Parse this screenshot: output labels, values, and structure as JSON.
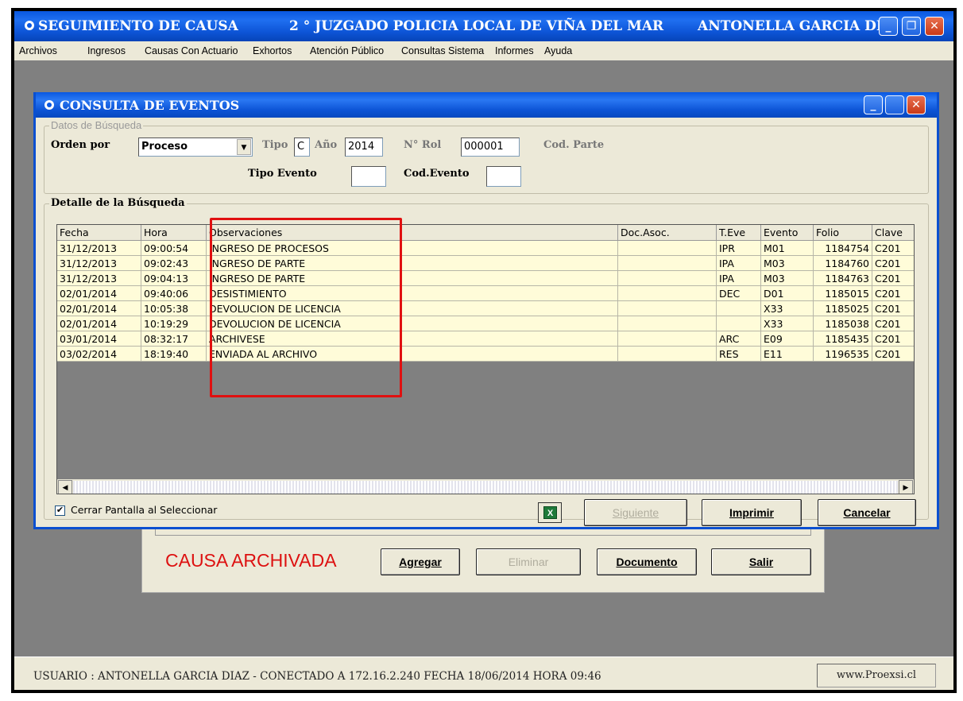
{
  "window": {
    "title_left": "SEGUIMIENTO DE CAUSA",
    "title_center": "2 ° JUZGADO POLICIA LOCAL DE VIÑA DEL MAR",
    "title_right": "ANTONELLA GARCIA DI...",
    "minimize": "_",
    "restore": "❐",
    "close": "✕"
  },
  "menu": [
    "Archivos",
    "Ingresos",
    "Causas Con Actuario",
    "Exhortos",
    "Atención Público",
    "Consultas Sistema",
    "Informes",
    "Ayuda"
  ],
  "dialog": {
    "title": "CONSULTA DE EVENTOS",
    "search_group": "Datos de Búsqueda",
    "orden_label": "Orden por",
    "orden_value": "Proceso",
    "tipo_label": "Tipo",
    "tipo_value": "C",
    "anio_label": "Año",
    "anio_value": "2014",
    "rol_label": "N° Rol",
    "rol_value": "000001",
    "cod_parte_label": "Cod. Parte",
    "tipo_evento_label": "Tipo Evento",
    "tipo_evento_value": "",
    "cod_evento_label": "Cod.Evento",
    "cod_evento_value": "",
    "detail_group": "Detalle de la Búsqueda",
    "columns": [
      "Fecha",
      "Hora",
      "Observaciones",
      "Doc.Asoc.",
      "T.Eve",
      "Evento",
      "Folio",
      "Clave"
    ],
    "rows": [
      {
        "fecha": "31/12/2013",
        "hora": "09:00:54",
        "obs": "INGRESO DE PROCESOS",
        "doc": "",
        "teve": "IPR",
        "evento": "M01",
        "folio": "1184754",
        "clave": "C201"
      },
      {
        "fecha": "31/12/2013",
        "hora": "09:02:43",
        "obs": "INGRESO DE PARTE",
        "doc": "",
        "teve": "IPA",
        "evento": "M03",
        "folio": "1184760",
        "clave": "C201"
      },
      {
        "fecha": "31/12/2013",
        "hora": "09:04:13",
        "obs": "INGRESO DE PARTE",
        "doc": "",
        "teve": "IPA",
        "evento": "M03",
        "folio": "1184763",
        "clave": "C201"
      },
      {
        "fecha": "02/01/2014",
        "hora": "09:40:06",
        "obs": "DESISTIMIENTO",
        "doc": "",
        "teve": "DEC",
        "evento": "D01",
        "folio": "1185015",
        "clave": "C201"
      },
      {
        "fecha": "02/01/2014",
        "hora": "10:05:38",
        "obs": "DEVOLUCION DE LICENCIA",
        "doc": "",
        "teve": "",
        "evento": "X33",
        "folio": "1185025",
        "clave": "C201"
      },
      {
        "fecha": "02/01/2014",
        "hora": "10:19:29",
        "obs": "DEVOLUCION DE LICENCIA",
        "doc": "",
        "teve": "",
        "evento": "X33",
        "folio": "1185038",
        "clave": "C201"
      },
      {
        "fecha": "03/01/2014",
        "hora": "08:32:17",
        "obs": "ARCHIVESE",
        "doc": "",
        "teve": "ARC",
        "evento": "E09",
        "folio": "1185435",
        "clave": "C201"
      },
      {
        "fecha": "03/02/2014",
        "hora": "18:19:40",
        "obs": "ENVIADA AL ARCHIVO",
        "doc": "",
        "teve": "RES",
        "evento": "E11",
        "folio": "1196535",
        "clave": "C201"
      }
    ],
    "close_on_select_label": "Cerrar Pantalla al Seleccionar",
    "close_on_select_checked": true,
    "excel_icon": "excel-icon",
    "btn_siguiente": "Siguiente",
    "btn_imprimir": "Imprimir",
    "btn_cancelar": "Cancelar"
  },
  "back_form": {
    "status": "CAUSA ARCHIVADA",
    "btn_agregar": "Agregar",
    "btn_eliminar": "Eliminar",
    "btn_documento": "Documento",
    "btn_salir": "Salir"
  },
  "statusbar": {
    "text": "USUARIO : ANTONELLA GARCIA DIAZ - CONECTADO A 172.16.2.240  FECHA 18/06/2014  HORA 09:46",
    "url": "www.Proexsi.cl"
  },
  "colors": {
    "titlebar": "#0a58e0",
    "grid_row": "#fffcd9",
    "highlight": "#e01010",
    "archivada": "#dd1111"
  }
}
